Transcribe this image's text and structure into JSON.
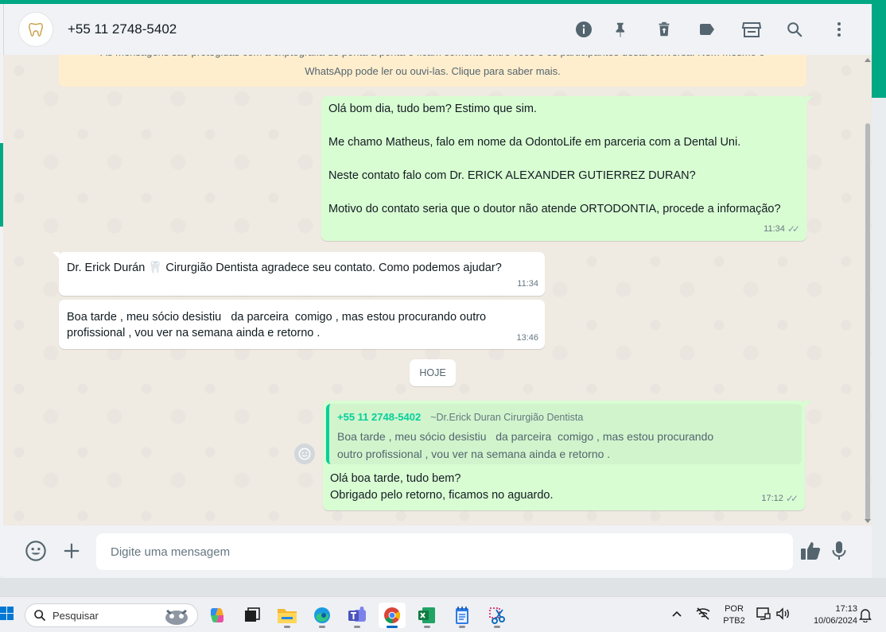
{
  "chat": {
    "contact_name": "+55 11 2748-5402",
    "encryption_notice_line1": "As mensagens são protegidas com a criptografia de ponta a ponta e ficam somente entre você e os participantes desta conversa. Nem mesmo o",
    "encryption_notice_line2": "WhatsApp pode ler ou ouvi-las. Clique para saber mais.",
    "messages": [
      {
        "direction": "out",
        "text": "Olá bom dia, tudo bem? Estimo que sim.\n\nMe chamo Matheus, falo em nome da OdontoLife em parceria com a Dental Uni.\n\nNeste contato falo com Dr. ERICK ALEXANDER GUTIERREZ DURAN?\n\nMotivo do contato seria que o doutor não atende ORTODONTIA, procede a informação?",
        "time": "11:34",
        "ticks": "✓✓"
      },
      {
        "direction": "in",
        "text": "Dr. Erick Durán 🦷 Cirurgião Dentista agradece seu contato. Como podemos ajudar?",
        "time": "11:34"
      },
      {
        "direction": "in",
        "text": "Boa tarde , meu sócio desistiu   da parceira  comigo , mas estou procurando outro\nprofissional , vou ver na semana ainda e retorno .",
        "time": "13:46"
      },
      {
        "direction": "out",
        "quote_name": "+55 11 2748-5402",
        "quote_alias": "~Dr.Erick Duran Cirurgião Dentista",
        "quote_text": "Boa tarde , meu sócio desistiu   da parceira  comigo , mas estou procurando\noutro profissional , vou ver na semana ainda e retorno .",
        "text": "Olá boa tarde, tudo bem?\nObrigado pelo retorno, ficamos no aguardo.",
        "time": "17:12",
        "ticks": "✓✓"
      }
    ],
    "day_separator": "HOJE"
  },
  "composer": {
    "placeholder": "Digite uma mensagem"
  },
  "header_icons": [
    "info-icon",
    "pin-icon",
    "delete-icon",
    "label-icon",
    "store-icon",
    "search-icon",
    "menu-icon"
  ],
  "taskbar": {
    "search_label": "Pesquisar",
    "lang_line1": "POR",
    "lang_line2": "PTB2",
    "clock_time": "17:13",
    "clock_date": "10/06/2024"
  },
  "colors": {
    "accent": "#00a884",
    "outgoing_bubble": "#d9fdd3",
    "incoming_bubble": "#ffffff",
    "chat_background": "#efeae2",
    "encryption_banner": "#ffeecd",
    "quote_name": "#06cf9c"
  }
}
